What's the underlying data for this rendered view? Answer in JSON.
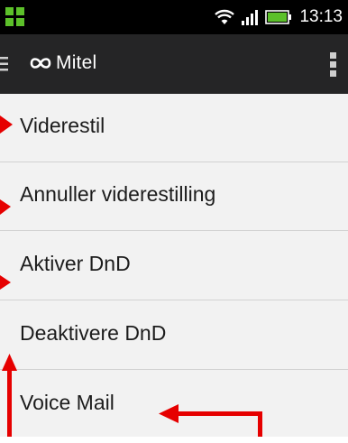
{
  "status_bar": {
    "time": "13:13",
    "icons": [
      "app-grid-icon",
      "wifi-icon",
      "signal-icon",
      "battery-icon"
    ]
  },
  "app_bar": {
    "logo_text": "Mitel",
    "icons": [
      "menu-icon",
      "mitel-logo-icon",
      "overflow-menu-icon"
    ]
  },
  "menu": {
    "items": [
      {
        "label": "Viderestil"
      },
      {
        "label": "Annuller viderestilling"
      },
      {
        "label": "Aktiver DnD"
      },
      {
        "label": "Deaktivere DnD"
      },
      {
        "label": "Voice Mail"
      }
    ]
  },
  "colors": {
    "status_bar_bg": "#000000",
    "app_bar_bg": "#252526",
    "list_bg": "#f2f2f2",
    "divider": "#d2d2d2",
    "annotation_arrow": "#e60000",
    "app_grid_icon": "#5cc02a"
  }
}
